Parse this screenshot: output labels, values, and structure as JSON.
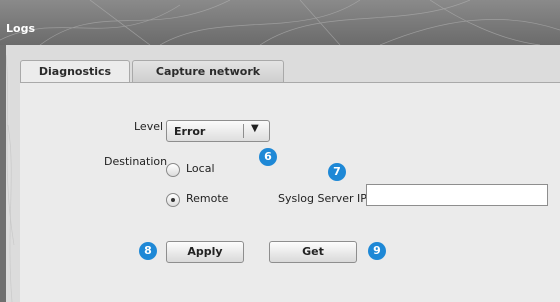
{
  "window": {
    "title": "Logs"
  },
  "tabs": [
    {
      "label": "Diagnostics",
      "active": true
    },
    {
      "label": "Capture network packets",
      "active": false
    }
  ],
  "form": {
    "level_label": "Level",
    "level_value": "Error",
    "destination_label": "Destination",
    "destination_options": [
      {
        "label": "Local",
        "selected": false
      },
      {
        "label": "Remote",
        "selected": true
      }
    ],
    "syslog_label": "Syslog Server IP",
    "syslog_value": ""
  },
  "buttons": {
    "apply": "Apply",
    "get": "Get"
  },
  "callouts": [
    "6",
    "7",
    "8",
    "9"
  ],
  "colors": {
    "callout": "#1e88d6",
    "titlebar": "#7a7a7a",
    "panel": "#ebebeb"
  }
}
